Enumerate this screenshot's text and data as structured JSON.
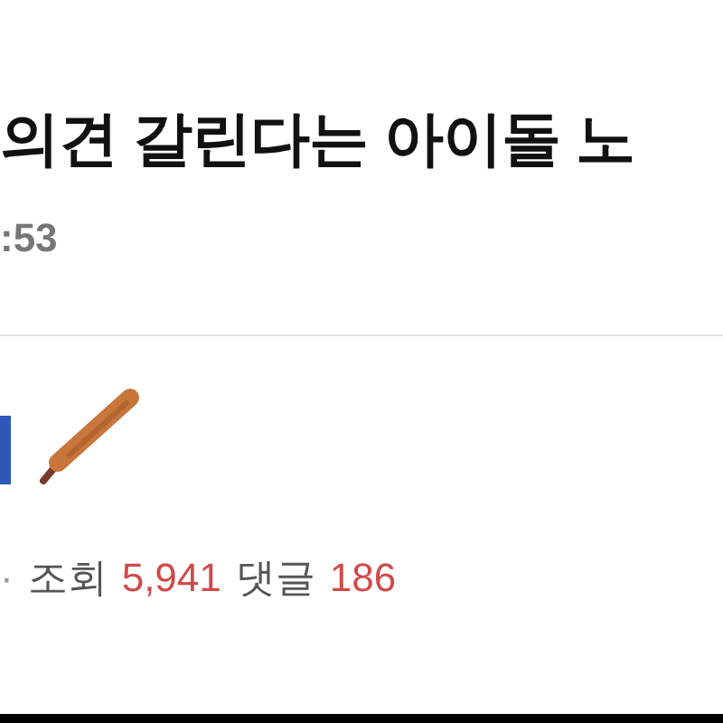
{
  "post": {
    "title": "의견 갈린다는 아이돌 노",
    "time": ":53"
  },
  "author": {
    "kind": "badge"
  },
  "stats": [
    {
      "kind": "separator",
      "text": "·"
    },
    {
      "kind": "label",
      "text": "조회"
    },
    {
      "kind": "count",
      "text": "5,941"
    },
    {
      "kind": "label",
      "text": "댓글"
    },
    {
      "kind": "count",
      "text": "186"
    }
  ]
}
